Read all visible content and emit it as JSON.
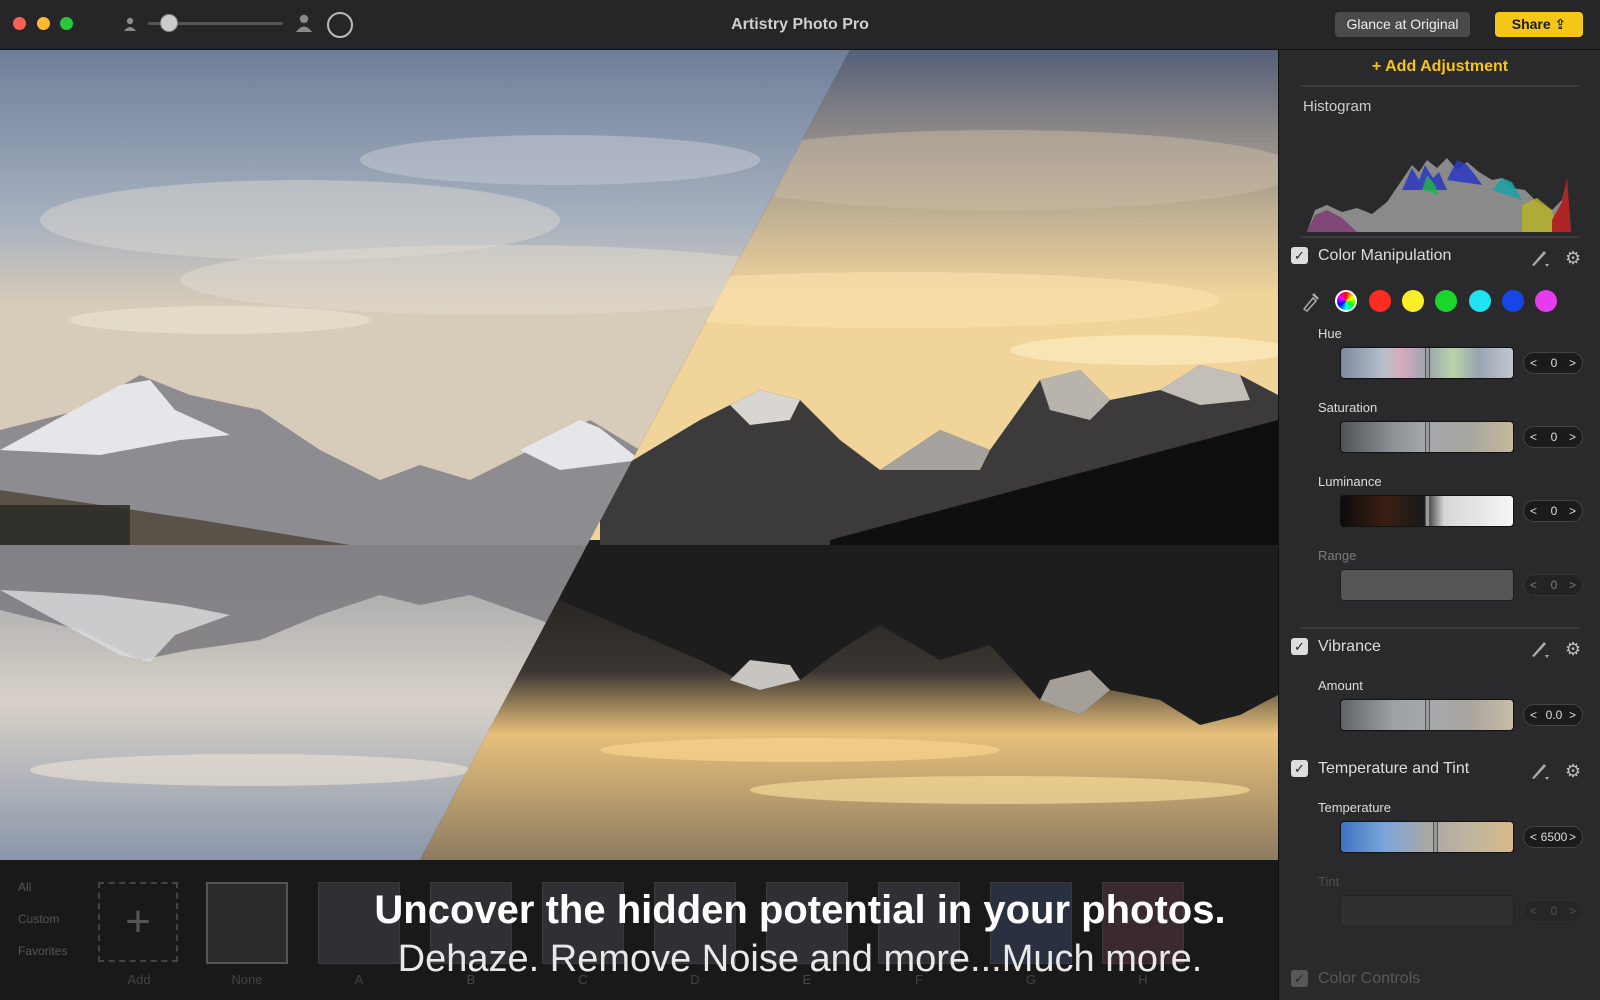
{
  "app": {
    "title": "Artistry Photo Pro"
  },
  "toolbar": {
    "glance_label": "Glance at Original",
    "share_label": "Share ⇪"
  },
  "panel": {
    "add_adjustment": "+ Add Adjustment",
    "histogram_title": "Histogram",
    "color_manipulation": {
      "title": "Color Manipulation",
      "checked": true,
      "swatches": [
        "#ffffff",
        "#ff3b30",
        "#ffeb3b",
        "#22c55e",
        "#22d3ee",
        "#1d4ed8",
        "#e040fb"
      ],
      "hue": {
        "label": "Hue",
        "value": "0"
      },
      "saturation": {
        "label": "Saturation",
        "value": "0"
      },
      "luminance": {
        "label": "Luminance",
        "value": "0"
      },
      "range": {
        "label": "Range",
        "value": "0"
      }
    },
    "vibrance": {
      "title": "Vibrance",
      "checked": true,
      "amount": {
        "label": "Amount",
        "value": "0.0"
      }
    },
    "temperature_tint": {
      "title": "Temperature and Tint",
      "checked": true,
      "temperature": {
        "label": "Temperature",
        "value": "6500"
      },
      "tint": {
        "label": "Tint",
        "value": "0"
      }
    },
    "color_controls": {
      "title": "Color Controls"
    }
  },
  "presets": {
    "categories": [
      "All",
      "Custom",
      "Favorites"
    ],
    "add_label": "Add",
    "none_label": "None",
    "letters": [
      "A",
      "B",
      "C",
      "D",
      "E",
      "F",
      "G",
      "H"
    ]
  },
  "caption": {
    "headline": "Uncover the hidden potential in your photos.",
    "subline": "Dehaze. Remove Noise and more...Much more."
  },
  "icons": {
    "stepper_left": "<",
    "stepper_right": ">",
    "gear": "⚙",
    "check": "✓"
  }
}
